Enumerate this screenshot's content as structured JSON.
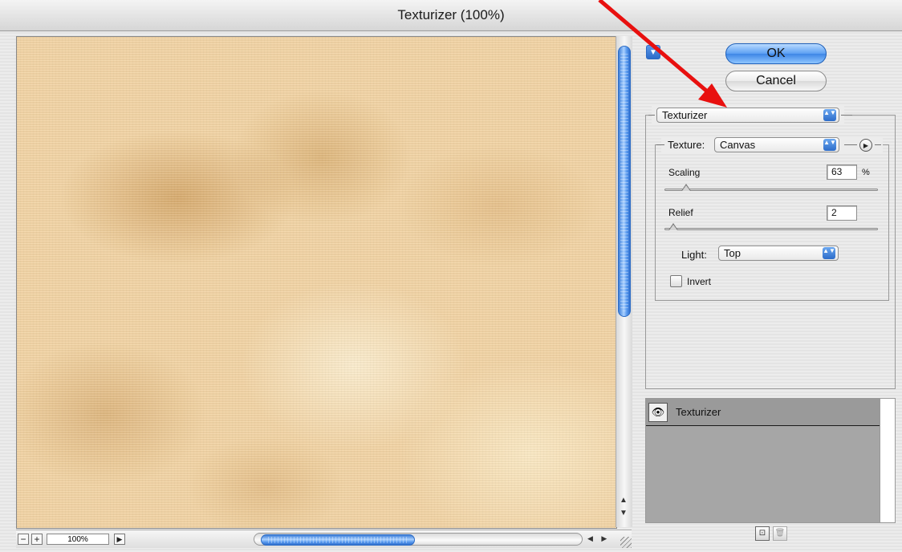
{
  "window": {
    "title": "Texturizer (100%)"
  },
  "preview": {
    "zoom_out_label": "−",
    "zoom_in_label": "+",
    "zoom_value": "100%",
    "menu_arrow": "▶",
    "scroll_up_glyph": "▲",
    "scroll_down_glyph": "▼",
    "scroll_left_right_glyph": "◀ ▶"
  },
  "buttons": {
    "ok_label": "OK",
    "cancel_label": "Cancel",
    "options_glyph": "▼"
  },
  "filter": {
    "selected": "Texturizer",
    "popup_glyph": "▲▼"
  },
  "settings": {
    "texture_label": "Texture:",
    "texture_value": "Canvas",
    "load_texture_glyph": "▶",
    "scaling_label": "Scaling",
    "scaling_value": "63",
    "scaling_unit": "%",
    "scaling_fraction": 0.1,
    "relief_label": "Relief",
    "relief_value": "2",
    "relief_fraction": 0.04,
    "light_label": "Light:",
    "light_value": "Top",
    "invert_label": "Invert",
    "invert_checked": false
  },
  "layers": {
    "items": [
      {
        "label": "Texturizer",
        "visible": true
      }
    ],
    "eye_glyph": "👁",
    "new_layer_glyph": "⊡",
    "delete_glyph": "🗑"
  },
  "colors": {
    "accent_blue": "#3e86e6",
    "annotation_arrow": "#e8100f",
    "preview_base": "#f3d5a6"
  }
}
